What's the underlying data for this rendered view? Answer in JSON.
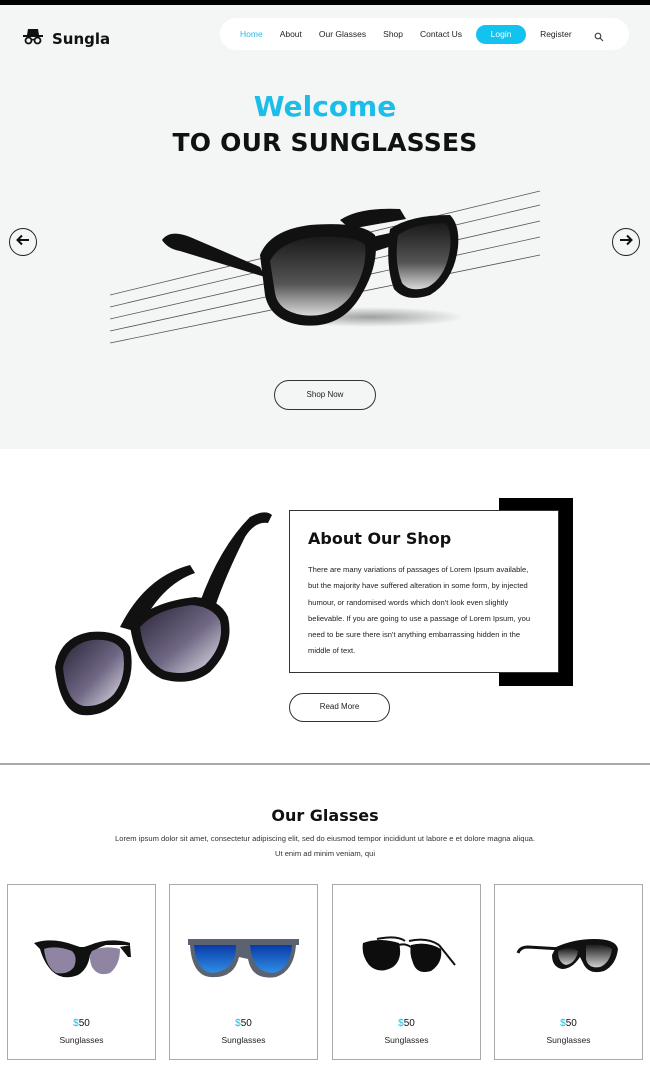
{
  "brand": {
    "name": "Sungla"
  },
  "nav": {
    "items": [
      "Home",
      "About",
      "Our Glasses",
      "Shop",
      "Contact Us"
    ],
    "login": "Login",
    "register": "Register"
  },
  "hero": {
    "welcome": "Welcome",
    "subtitle": "TO OUR SUNGLASSES",
    "button": "Shop Now"
  },
  "about": {
    "title": "About Our Shop",
    "text": "There are many variations of passages of Lorem Ipsum available, but the majority have suffered alteration in some form, by injected humour, or randomised words which don't look even slightly believable. If you are going to use a passage of Lorem Ipsum, you need to be sure there isn't anything embarrassing hidden in the middle of text.",
    "button": "Read More"
  },
  "glasses": {
    "title": "Our Glasses",
    "description": "Lorem ipsum dolor sit amet, consectetur adipiscing elit, sed do eiusmod tempor incididunt ut labore e et dolore magna aliqua. Ut enim ad minim veniam, qui",
    "currency": "$",
    "products": [
      {
        "price": "50",
        "name": "Sunglasses"
      },
      {
        "price": "50",
        "name": "Sunglasses"
      },
      {
        "price": "50",
        "name": "Sunglasses"
      },
      {
        "price": "50",
        "name": "Sunglasses"
      }
    ]
  },
  "colors": {
    "accent": "#1bbde9",
    "dark": "#111111",
    "hero_bg": "#f4f5f5"
  },
  "icons": [
    "hat-glasses-logo-icon",
    "search-icon",
    "arrow-left-icon",
    "arrow-right-icon"
  ]
}
